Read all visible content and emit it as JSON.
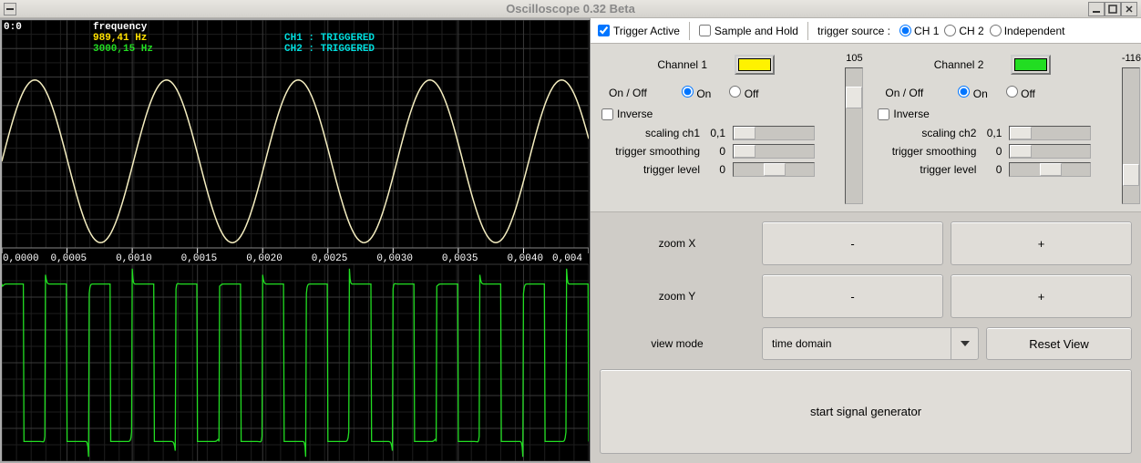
{
  "window": {
    "title": "Oscilloscope 0.32 Beta"
  },
  "scope": {
    "coord": "0:0",
    "freq_label": "frequency",
    "freq_ch1": "989,41 Hz",
    "freq_ch2": "3000,15 Hz",
    "status_ch1": "CH1 : TRIGGERED",
    "status_ch2": "CH2 : TRIGGERED",
    "timeaxis": [
      "0,0000",
      "0,0005",
      "0,0010",
      "0,0015",
      "0,0020",
      "0,0025",
      "0,0030",
      "0,0035",
      "0,0040",
      "0,004"
    ]
  },
  "topbar": {
    "trigger_active": "Trigger Active",
    "sample_hold": "Sample and Hold",
    "trigger_source_label": "trigger source :",
    "ch1": "CH 1",
    "ch2": "CH 2",
    "independent": "Independent"
  },
  "ch1": {
    "title": "Channel 1",
    "swatch_color": "#fff200",
    "onoff_label": "On / Off",
    "on": "On",
    "off": "Off",
    "inverse": "Inverse",
    "scaling_label": "scaling ch1",
    "scaling_val": "0,1",
    "smoothing_label": "trigger smoothing",
    "smoothing_val": "0",
    "level_label": "trigger level",
    "level_val": "0",
    "vslider_val": "105"
  },
  "ch2": {
    "title": "Channel 2",
    "swatch_color": "#22dd22",
    "onoff_label": "On / Off",
    "on": "On",
    "off": "Off",
    "inverse": "Inverse",
    "scaling_label": "scaling ch2",
    "scaling_val": "0,1",
    "smoothing_label": "trigger smoothing",
    "smoothing_val": "0",
    "level_label": "trigger level",
    "level_val": "0",
    "vslider_val": "-116"
  },
  "bottom": {
    "zoom_x": "zoom X",
    "zoom_y": "zoom Y",
    "minus": "-",
    "plus": "+",
    "view_mode": "view mode",
    "view_mode_value": "time domain",
    "reset_view": "Reset View",
    "start_gen": "start signal generator"
  },
  "chart_data": [
    {
      "type": "line",
      "channel": "CH1",
      "color": "#f5eec0",
      "description": "sine wave ~989.41 Hz, ~4.5 cycles across 0.0045 s window",
      "xlim": [
        0,
        0.0045
      ],
      "ylim": [
        -1,
        1
      ],
      "x_tick_spacing": 0.0005,
      "period_s": 0.00101,
      "amplitude_norm": 0.85,
      "status": "TRIGGERED"
    },
    {
      "type": "line",
      "channel": "CH2",
      "color": "#22dd22",
      "description": "square wave with ringing ~3000.15 Hz, ~13.5 cycles across 0.0045 s window",
      "xlim": [
        0,
        0.0045
      ],
      "ylim": [
        -1,
        1
      ],
      "x_tick_spacing": 0.0005,
      "period_s": 0.000333,
      "amplitude_norm": 0.8,
      "status": "TRIGGERED"
    }
  ]
}
